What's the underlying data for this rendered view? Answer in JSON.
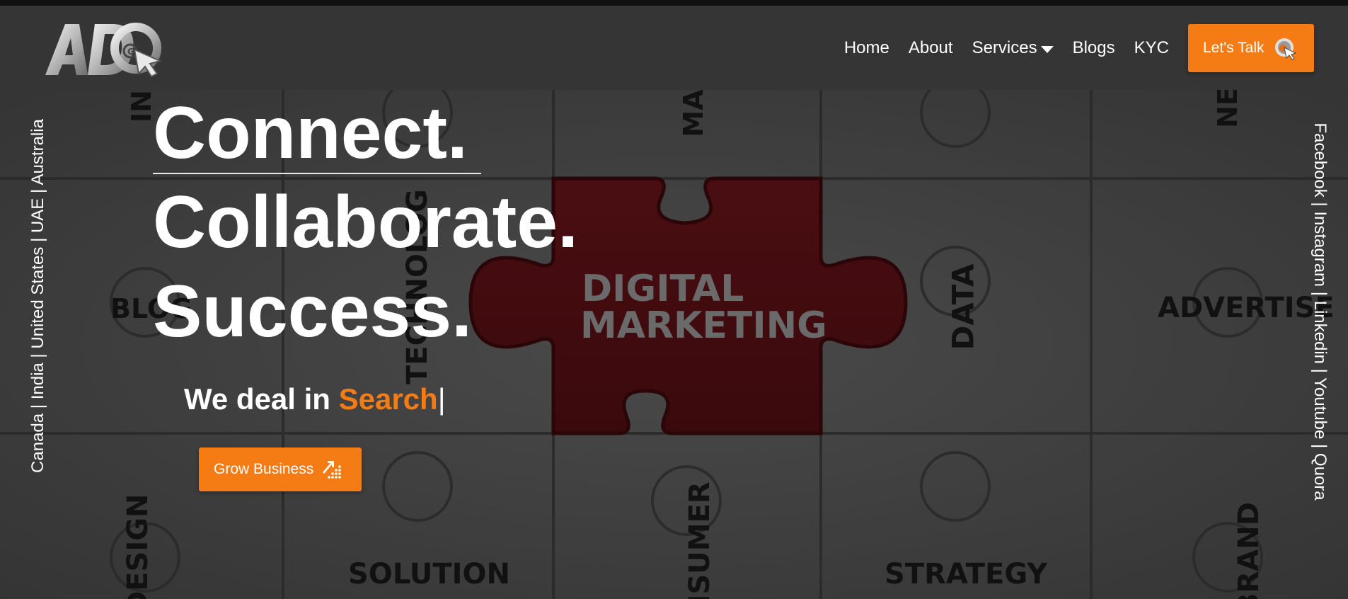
{
  "brand": {
    "logo_text": "ADG",
    "accent_color": "#f57c14"
  },
  "nav": {
    "items": [
      {
        "label": "Home"
      },
      {
        "label": "About"
      },
      {
        "label": "Services",
        "has_dropdown": true
      },
      {
        "label": "Blogs"
      },
      {
        "label": "KYC"
      }
    ],
    "cta_label": "Let's Talk",
    "cta_icon": "cursor-logo-icon"
  },
  "hero": {
    "line1": "Connect.",
    "line2": "Collaborate.",
    "line3": "Success.",
    "deal_prefix": "We deal in ",
    "deal_highlight": "Search",
    "deal_cursor": "|",
    "cta_label": "Grow Business",
    "cta_icon": "growth-chart-icon"
  },
  "side": {
    "locations": "Canada | India | United States | UAE | Australia",
    "socials": "Facebook | Instagram | Linkedin | Youtube | Quora"
  },
  "background_words": {
    "digital": "DIGITAL",
    "marketing": "MARKETING",
    "blog": "BLOG",
    "technology": "TECHNOLOG",
    "data": "DATA",
    "advertise": "ADVERTISE",
    "solution": "SOLUTION",
    "strategy": "STRATEGY",
    "consumer": "NSUMER",
    "design": "DESIGN",
    "brand": "BRAND",
    "in": "IN",
    "ma": "MA",
    "ne": "NE"
  }
}
